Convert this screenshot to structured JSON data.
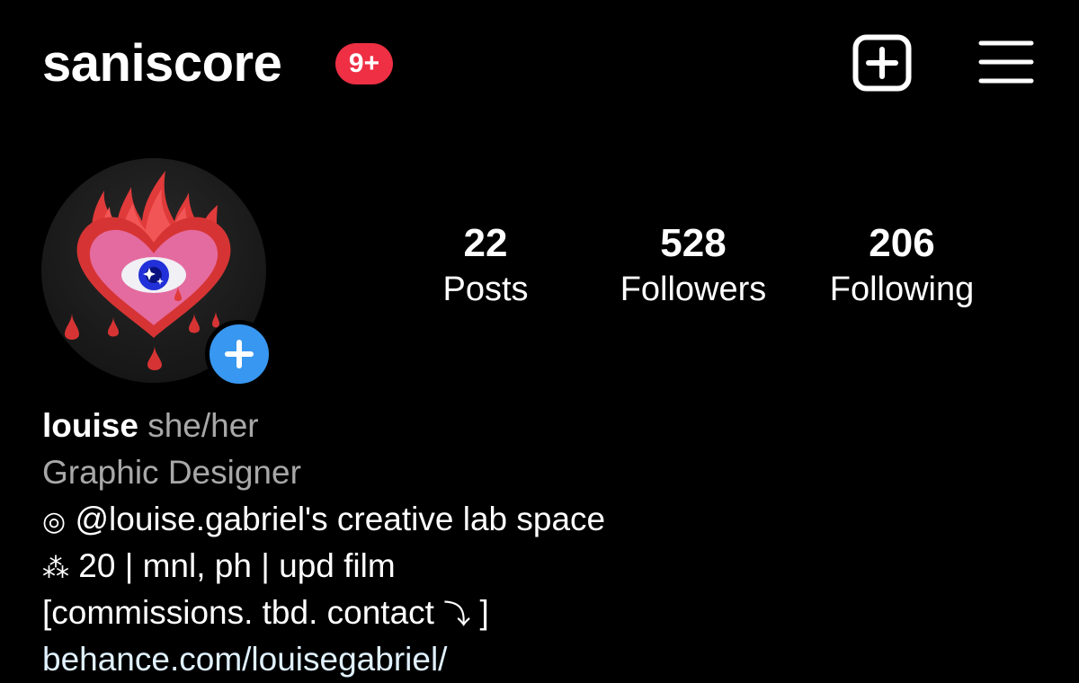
{
  "header": {
    "username": "saniscore",
    "notification_badge": "9+",
    "badge_color": "#ee2f44",
    "new_post_icon": "plus-square-icon",
    "menu_icon": "hamburger-menu-icon"
  },
  "profile": {
    "avatar_icon": "flaming-heart-eye-avatar",
    "add_story_icon": "plus-icon",
    "add_story_color": "#3897f0",
    "stats": [
      {
        "value": "22",
        "label": "Posts"
      },
      {
        "value": "528",
        "label": "Followers"
      },
      {
        "value": "206",
        "label": "Following"
      }
    ]
  },
  "bio": {
    "name": "louise",
    "pronouns": "she/her",
    "category": "Graphic Designer",
    "line1_glyph": "◎",
    "line1_text": "@louise.gabriel's creative lab space",
    "line2_glyph": "⁂",
    "line2_text": "20 | mnl, ph | upd film",
    "line3_text": "[commissions. tbd. contact",
    "line3_glyph": "⤵",
    "line3_close": "]",
    "website": "behance.com/louisegabriel/"
  }
}
